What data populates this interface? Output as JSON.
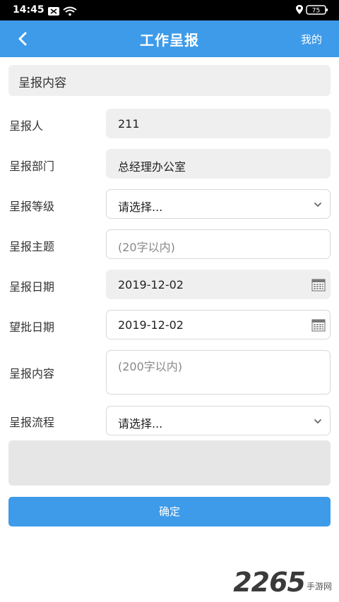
{
  "status_bar": {
    "time": "14:45",
    "battery": "75"
  },
  "nav": {
    "title": "工作呈报",
    "right_label": "我的"
  },
  "section": {
    "title": "呈报内容"
  },
  "form": {
    "reporter": {
      "label": "呈报人",
      "value": "211"
    },
    "department": {
      "label": "呈报部门",
      "value": "总经理办公室"
    },
    "level": {
      "label": "呈报等级",
      "value": "请选择..."
    },
    "subject": {
      "label": "呈报主题",
      "placeholder": "(20字以内)"
    },
    "report_date": {
      "label": "呈报日期",
      "value": "2019-12-02"
    },
    "approve_date": {
      "label": "望批日期",
      "value": "2019-12-02"
    },
    "content": {
      "label": "呈报内容",
      "placeholder": "(200字以内)"
    },
    "flow": {
      "label": "呈报流程",
      "value": "请选择..."
    }
  },
  "confirm_label": "确定",
  "watermark": {
    "number": "2265",
    "site": "手游网"
  },
  "colors": {
    "accent": "#3d9be9",
    "field_gray": "#efefef"
  }
}
